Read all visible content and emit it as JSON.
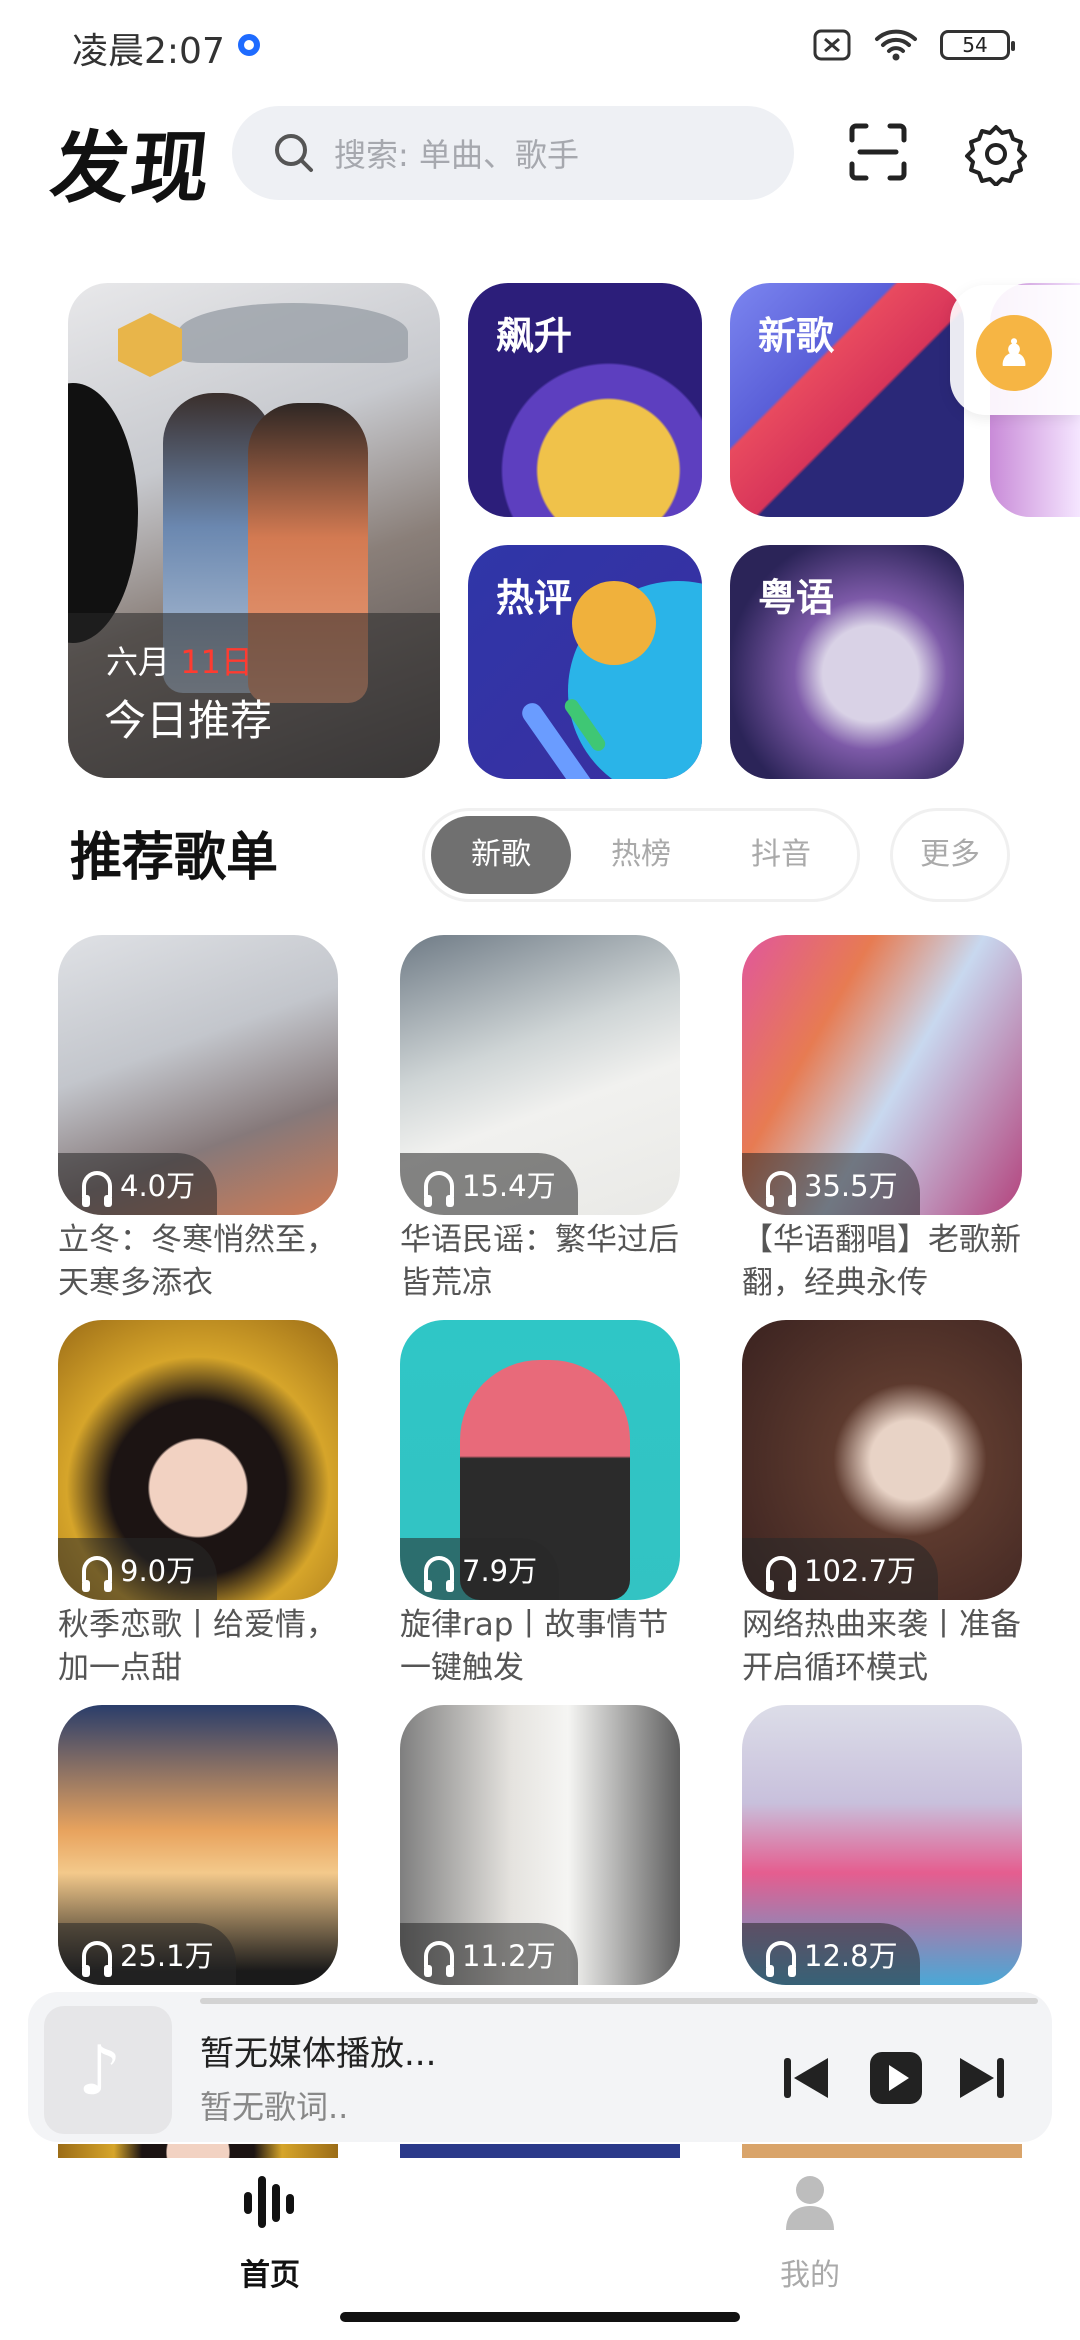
{
  "status_bar": {
    "time": "凌晨2:07",
    "battery": "54"
  },
  "header": {
    "title": "发现",
    "search_placeholder": "搜索: 单曲、歌手"
  },
  "featured": {
    "today": {
      "month": "六月",
      "day": "11日",
      "title": "今日推荐"
    },
    "tiles": [
      {
        "label": "飙升"
      },
      {
        "label": "新歌"
      },
      {
        "label": "热评"
      },
      {
        "label": "粤语"
      }
    ]
  },
  "playlists_section": {
    "title": "推荐歌单",
    "tabs": [
      "新歌",
      "热榜",
      "抖音"
    ],
    "active_tab": "新歌",
    "more": "更多",
    "items": [
      {
        "plays": "4.0万",
        "name": "立冬：冬寒悄然至，天寒多添衣"
      },
      {
        "plays": "15.4万",
        "name": "华语民谣：繁华过后皆荒凉"
      },
      {
        "plays": "35.5万",
        "name": "【华语翻唱】老歌新翻，经典永传"
      },
      {
        "plays": "9.0万",
        "name": "秋季恋歌丨给爱情，加一点甜"
      },
      {
        "plays": "7.9万",
        "name": "旋律rap丨故事情节一键触发"
      },
      {
        "plays": "102.7万",
        "name": "网络热曲来袭丨准备开启循环模式"
      },
      {
        "plays": "25.1万",
        "name": ""
      },
      {
        "plays": "11.2万",
        "name": ""
      },
      {
        "plays": "12.8万",
        "name": ""
      }
    ]
  },
  "player": {
    "title": "暂无媒体播放...",
    "lyrics": "暂无歌词.."
  },
  "bottom_nav": {
    "home": "首页",
    "me": "我的"
  },
  "colors": {
    "accent_red": "#ff3b30",
    "search_bg": "#eef0f4",
    "tab_active": "#707070"
  }
}
